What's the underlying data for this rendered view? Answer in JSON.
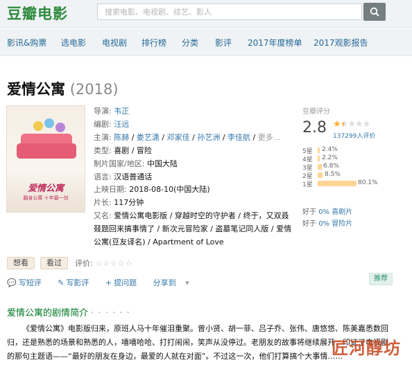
{
  "header": {
    "logo": "豆瓣电影",
    "search_placeholder": "搜索电影、电视剧、综艺、影人"
  },
  "nav": [
    "影讯&购票",
    "选电影",
    "电视剧",
    "排行榜",
    "分类",
    "影评",
    "2017年度榜单",
    "2017观影报告"
  ],
  "movie": {
    "title": "爱情公寓",
    "year": "(2018)",
    "poster_title": "爱情公寓",
    "poster_subtitle": "翻身公寓 十年磨一剑"
  },
  "info": {
    "director_label": "导演:",
    "director": "韦正",
    "writer_label": "编剧:",
    "writer": "汪远",
    "cast_label": "主演:",
    "cast": [
      "陈赫",
      "娄艺潇",
      "邓家佳",
      "孙艺洲",
      "李佳航"
    ],
    "cast_more": "更多...",
    "genre_label": "类型:",
    "genre": "喜剧 / 冒险",
    "region_label": "制片国家/地区:",
    "region": "中国大陆",
    "language_label": "语言:",
    "language": "汉语普通话",
    "release_label": "上映日期:",
    "release": "2018-08-10(中国大陆)",
    "runtime_label": "片长:",
    "runtime": "117分钟",
    "aka_label": "又名:",
    "aka": "爱情公寓电影版 / 穿越时空的守护者 / 终于，又双叒叕题回来搞事情了 / 新次元冒险家 / 盗墓笔记同人版 / 爱情公寓(豆友译名) / Apartment of Love"
  },
  "rating": {
    "label": "豆瓣评分",
    "score": "2.8",
    "stars_filled": 1.5,
    "count": "137299人评价",
    "breakdown": [
      {
        "star": "5星",
        "pct": "2.4%",
        "value": 2.4
      },
      {
        "star": "4星",
        "pct": "2.2%",
        "value": 2.2
      },
      {
        "star": "3星",
        "pct": "6.8%",
        "value": 6.8
      },
      {
        "star": "2星",
        "pct": "8.5%",
        "value": 8.5
      },
      {
        "star": "1星",
        "pct": "80.1%",
        "value": 80.1
      }
    ],
    "better_prefix": "好于",
    "better1": "0% 喜剧片",
    "better2": "0% 冒险片"
  },
  "interest": {
    "want": "想看",
    "seen": "看过",
    "my_rate": "评价:",
    "my_rate_stars": "☆☆☆☆☆"
  },
  "actions": {
    "short_review": "写短评",
    "review": "写影评",
    "question": "提问题",
    "share": "分享到",
    "recommend": "推荐"
  },
  "summary": {
    "title": "爱情公寓的剧情简介",
    "dots": "· · · · · ·",
    "text": "《爱情公寓》电影版归来，原班人马十年催泪重聚。曾小贤、胡一菲、吕子乔、张伟、唐悠悠、陈美嘉悉数回归，还是熟悉的场景和熟悉的人，嘻嘻哈哈、打打闹闹，笑声从没停过。老朋友的故事将继续展开，印证了电视剧的那句主题语——“最好的朋友在身边，最爱的人就在对面”。不过这一次，他们打算搞个大事情……"
  },
  "watermark": "匠河醇坊",
  "colors": {
    "brand_green": "#2e8b3e",
    "link": "#3377aa",
    "star": "#ffac2d",
    "bar": "#ffd596"
  }
}
